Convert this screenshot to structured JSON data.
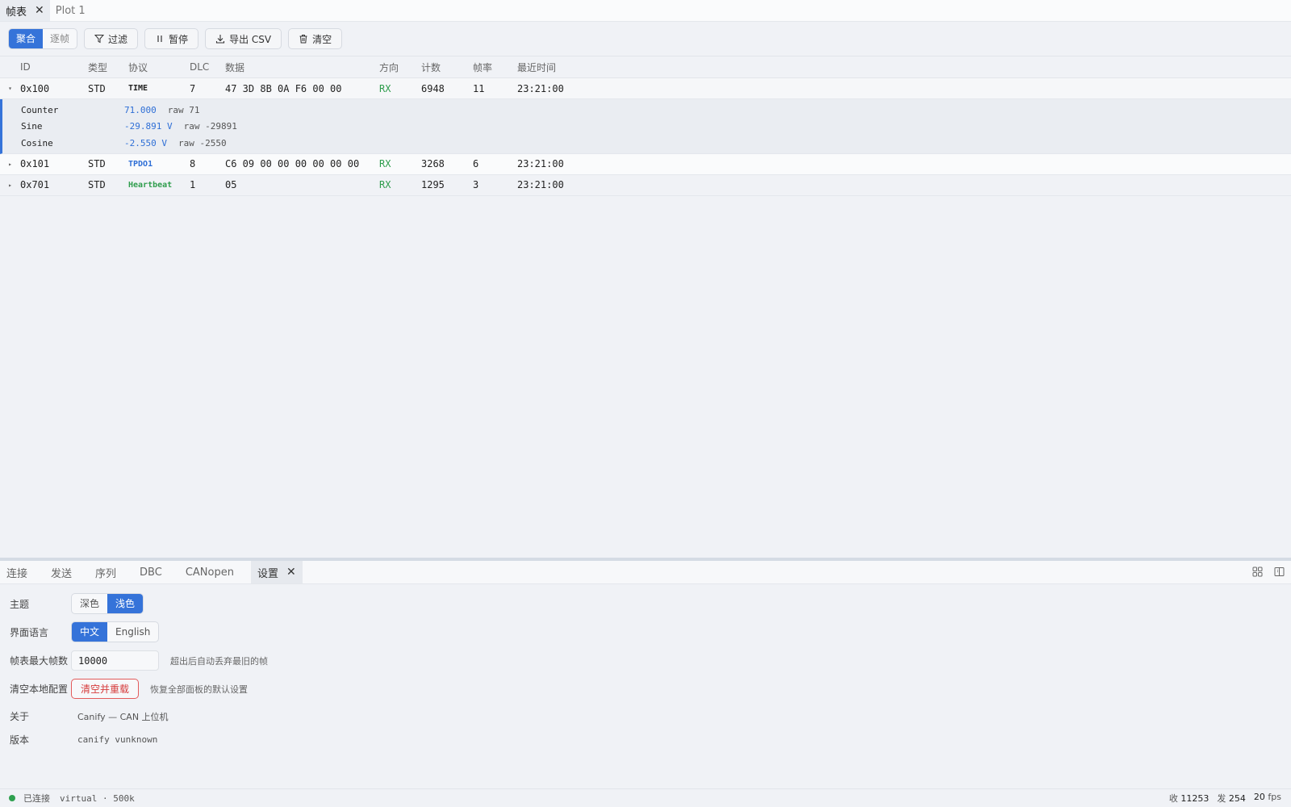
{
  "top_tabs": [
    {
      "label": "帧表"
    },
    {
      "label": "Plot 1"
    }
  ],
  "toolbar": {
    "mode_aggregate": "聚合",
    "mode_per_frame": "逐帧",
    "filter": "过滤",
    "pause": "暂停",
    "export_csv": "导出 CSV",
    "clear": "清空"
  },
  "table": {
    "headers": {
      "id": "ID",
      "type": "类型",
      "protocol": "协议",
      "dlc": "DLC",
      "data": "数据",
      "direction": "方向",
      "count": "计数",
      "rate": "帧率",
      "last_time": "最近时间"
    },
    "rows": [
      {
        "id": "0x100",
        "type": "STD",
        "protocol": "TIME",
        "dlc": "7",
        "data": "47 3D 8B 0A F6 00 00",
        "direction": "RX",
        "count": "6948",
        "rate": "11",
        "last_time": "23:21:00",
        "expanded": true
      },
      {
        "id": "0x101",
        "type": "STD",
        "protocol": "TPDO1",
        "dlc": "8",
        "data": "C6 09 00 00 00 00 00 00",
        "direction": "RX",
        "count": "3268",
        "rate": "6",
        "last_time": "23:21:00"
      },
      {
        "id": "0x701",
        "type": "STD",
        "protocol": "Heartbeat",
        "dlc": "1",
        "data": "05",
        "direction": "RX",
        "count": "1295",
        "rate": "3",
        "last_time": "23:21:00"
      }
    ],
    "signals": [
      {
        "name": "Counter",
        "value": "71.000",
        "raw": "raw 71"
      },
      {
        "name": "Sine",
        "value": "-29.891 V",
        "raw": "raw -29891"
      },
      {
        "name": "Cosine",
        "value": "-2.550 V",
        "raw": "raw -2550"
      }
    ]
  },
  "bottom_tabs": [
    {
      "label": "连接"
    },
    {
      "label": "发送"
    },
    {
      "label": "序列"
    },
    {
      "label": "DBC"
    },
    {
      "label": "CANopen"
    },
    {
      "label": "设置"
    }
  ],
  "settings": {
    "theme_label": "主题",
    "theme_dark": "深色",
    "theme_light": "浅色",
    "language_label": "界面语言",
    "lang_zh": "中文",
    "lang_en": "English",
    "max_frames_label": "帧表最大帧数",
    "max_frames_value": "10000",
    "max_frames_hint": "超出后自动丢弃最旧的帧",
    "clear_local_label": "清空本地配置",
    "clear_reload_button": "清空并重载",
    "clear_local_hint": "恢复全部面板的默认设置",
    "about_label": "关于",
    "about_value": "Canify — CAN 上位机",
    "version_label": "版本",
    "version_value": "canify vunknown"
  },
  "status": {
    "connected": "已连接",
    "device": "virtual · 500k",
    "rx_label": "收",
    "rx_value": "11253",
    "tx_label": "发",
    "tx_value": "254",
    "fps_value": "20",
    "fps_unit": "fps"
  },
  "colors": {
    "accent": "#3573d9",
    "rx_green": "#2f9d4d",
    "danger": "#d63c3c"
  }
}
